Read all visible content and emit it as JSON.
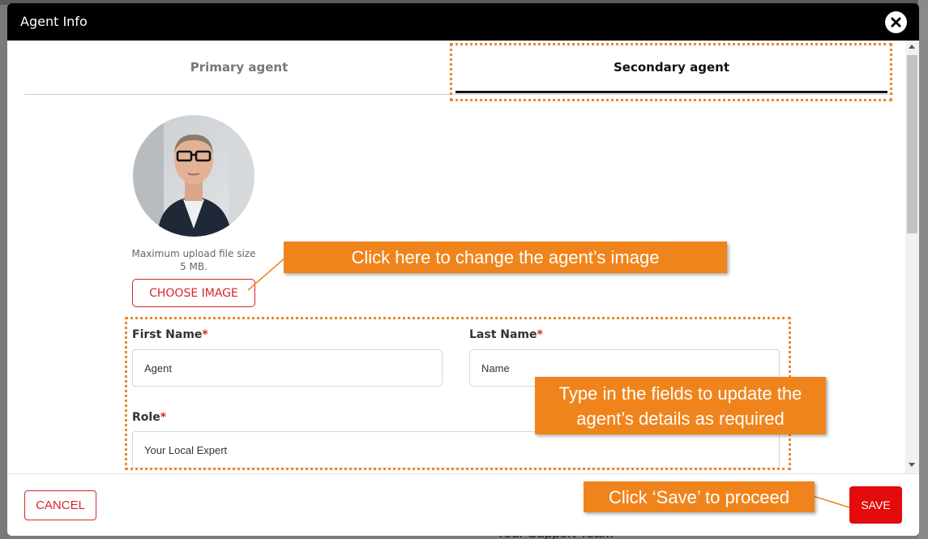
{
  "modal": {
    "title": "Agent Info"
  },
  "tabs": [
    {
      "label": "Primary agent"
    },
    {
      "label": "Secondary agent"
    }
  ],
  "upload": {
    "note_line1": "Maximum upload file size",
    "note_line2": "5 MB.",
    "button_label": "CHOOSE IMAGE"
  },
  "form": {
    "first_name": {
      "label": "First Name",
      "value": "Agent"
    },
    "last_name": {
      "label": "Last Name",
      "value": "Name"
    },
    "role": {
      "label": "Role",
      "value": "Your Local Expert"
    },
    "required_marker": "*"
  },
  "footer": {
    "cancel_label": "CANCEL",
    "save_label": "SAVE"
  },
  "background": {
    "footer_text": "Your Support Team"
  },
  "annotations": {
    "image_callout": "Click here to change the agent’s image",
    "fields_callout_line1": "Type in the fields to update the",
    "fields_callout_line2": "agent’s details as required",
    "save_callout": "Click ‘Save’ to proceed"
  },
  "colors": {
    "accent_red": "#e30b0b",
    "annotation_orange": "#f0841c",
    "header_black": "#000000"
  }
}
